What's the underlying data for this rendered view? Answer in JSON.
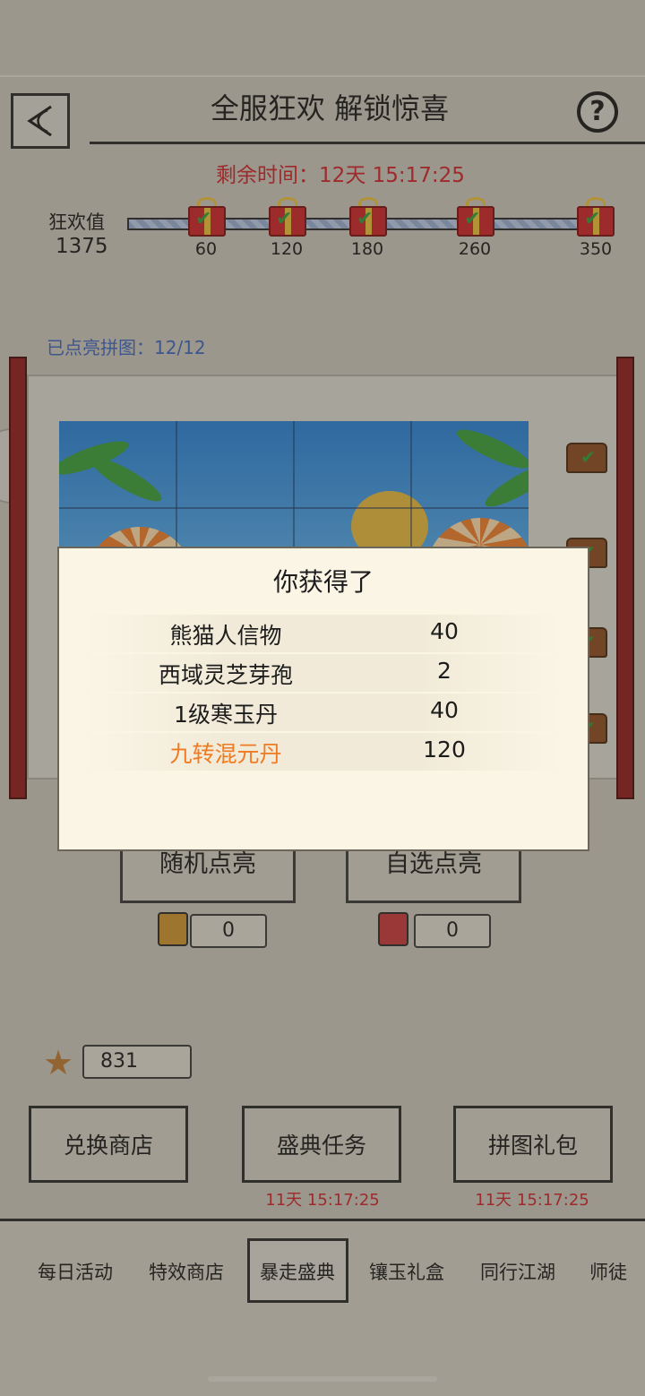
{
  "header": {
    "title": "全服狂欢 解锁惊喜",
    "help_label": "?"
  },
  "timer": "剩余时间：12天 15:17:25",
  "carnival": {
    "label": "狂欢值",
    "value": "1375",
    "milestones": [
      "60",
      "120",
      "180",
      "260",
      "350"
    ]
  },
  "puzzle": {
    "count_text": "已点亮拼图：12/12"
  },
  "actions": {
    "random_label": "随机点亮",
    "custom_label": "自选点亮",
    "random_count": "0",
    "custom_count": "0"
  },
  "currency": {
    "value": "831"
  },
  "buttons": {
    "shop": "兑换商店",
    "task": "盛典任务",
    "task_timer": "11天 15:17:25",
    "pack": "拼图礼包",
    "pack_timer": "11天 15:17:25"
  },
  "nav": {
    "items": [
      "每日活动",
      "特效商店",
      "暴走盛典",
      "镶玉礼盒",
      "同行江湖",
      "师徒"
    ],
    "active_index": 2
  },
  "modal": {
    "title": "你获得了",
    "rewards": [
      {
        "name": "熊猫人信物",
        "qty": "40"
      },
      {
        "name": "西域灵芝芽孢",
        "qty": "2"
      },
      {
        "name": "1级寒玉丹",
        "qty": "40"
      },
      {
        "name": "九转混元丹",
        "qty": "120",
        "highlight": "#ef7b22"
      }
    ]
  }
}
